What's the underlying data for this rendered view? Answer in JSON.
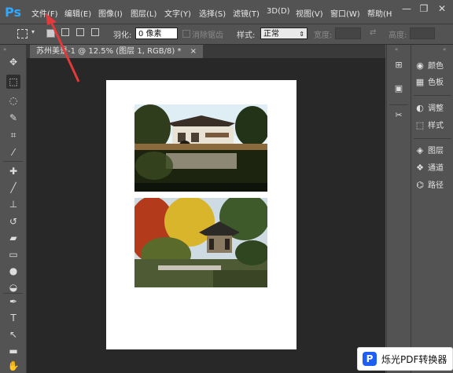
{
  "app": {
    "logo": "Ps"
  },
  "menu": [
    "文件(F)",
    "编辑(E)",
    "图像(I)",
    "图层(L)",
    "文字(Y)",
    "选择(S)",
    "滤镜(T)",
    "3D(D)",
    "视图(V)",
    "窗口(W)",
    "帮助(H"
  ],
  "window_controls": {
    "minimize": "—",
    "restore": "❐",
    "close": "✕"
  },
  "options": {
    "feather_label": "羽化:",
    "feather_value": "0 像素",
    "antialias_label": "消除锯齿",
    "style_label": "样式:",
    "style_value": "正常",
    "width_label": "宽度:",
    "height_label": "高度:"
  },
  "document": {
    "tab_title": "苏州美景-1 @ 12.5% (图层 1, RGB/8) *",
    "close": "×"
  },
  "panels": {
    "right": [
      {
        "label": "颜色",
        "icon": "color-icon"
      },
      {
        "label": "色板",
        "icon": "swatches-icon"
      },
      {
        "label": "调整",
        "icon": "adjustments-icon"
      },
      {
        "label": "样式",
        "icon": "styles-icon"
      },
      {
        "label": "图层",
        "icon": "layers-icon"
      },
      {
        "label": "通道",
        "icon": "channels-icon"
      },
      {
        "label": "路径",
        "icon": "paths-icon"
      }
    ]
  },
  "watermark": {
    "icon": "P",
    "text": "烁光PDF转换器"
  },
  "colors": {
    "accent": "#31a8ff",
    "arrow": "#e23a3a",
    "workspace": "#535353",
    "canvas_bg": "#282828"
  }
}
